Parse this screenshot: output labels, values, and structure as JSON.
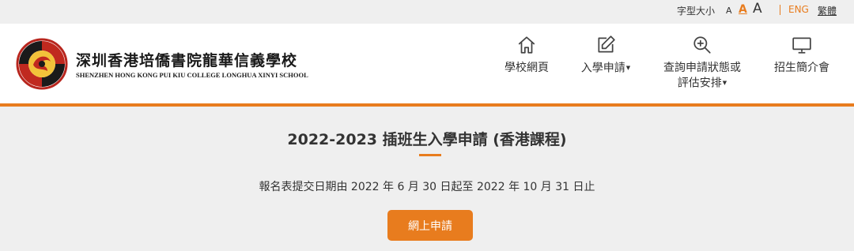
{
  "topbar": {
    "font_size_label": "字型大小",
    "font_small": "A",
    "font_medium": "A",
    "font_large": "A",
    "lang_english": "ENG",
    "lang_traditional": "繁體"
  },
  "header": {
    "school_name_cn": "深圳香港培僑書院龍華信義學校",
    "school_name_en": "SHENZHEN HONG KONG PUI KIU COLLEGE LONGHUA XINYI SCHOOL"
  },
  "nav": {
    "items": [
      {
        "label": "學校網頁",
        "icon": "home-icon"
      },
      {
        "label": "入學申請",
        "icon": "edit-icon",
        "dropdown": true
      },
      {
        "label_line1": "查詢申請狀態或",
        "label_line2": "評估安排",
        "icon": "search-icon",
        "dropdown": true
      },
      {
        "label": "招生簡介會",
        "icon": "monitor-icon"
      }
    ]
  },
  "main": {
    "title": "2022-2023 插班生入學申請 (香港課程)",
    "period": "報名表提交日期由 2022 年 6 月 30 日起至 2022 年 10 月 31 日止",
    "apply_button": "網上申請"
  },
  "colors": {
    "accent": "#e87c1e",
    "background": "#efefef",
    "header_bg": "#ffffff"
  }
}
